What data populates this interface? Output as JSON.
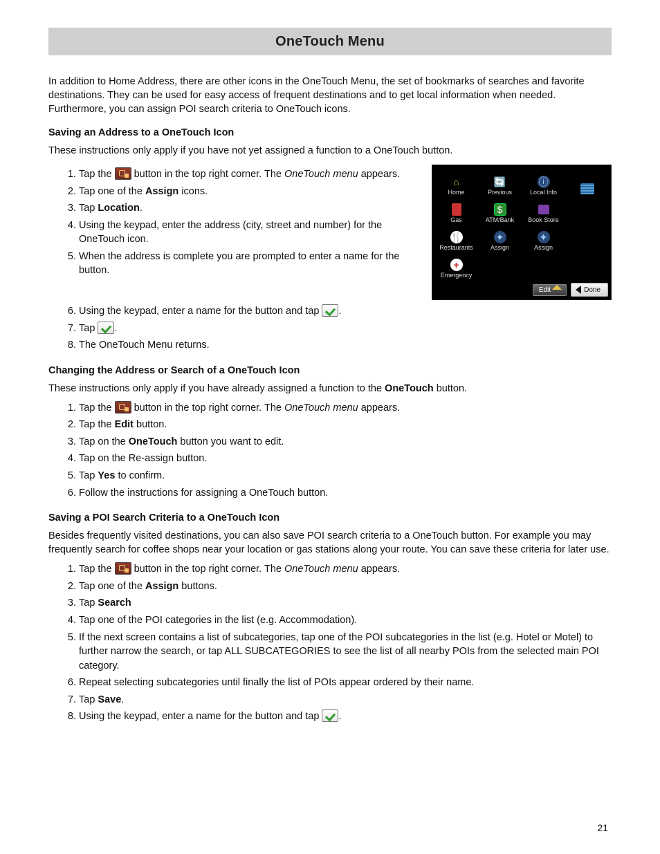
{
  "header_title": "OneTouch Menu",
  "intro": "In addition to Home Address, there are other icons in the OneTouch Menu, the set of bookmarks of searches and favorite destinations. They can be used for easy access of frequent destinations and to get local information when needed. Furthermore, you can assign POI search criteria to OneTouch icons.",
  "page_number": "21",
  "icon_names": {
    "onetouch": "onetouch-button-icon",
    "check": "confirm-check-icon"
  },
  "sec1": {
    "heading": "Saving an Address to a OneTouch Icon",
    "lead": "These instructions only apply if you have not yet assigned a function to a OneTouch button.",
    "steps": {
      "s1a": "Tap the ",
      "s1b": " button in the top right corner. The ",
      "s1c": "OneTouch menu",
      "s1d": " appears.",
      "s2a": "Tap one of the ",
      "s2b": "Assign",
      "s2c": " icons.",
      "s3a": "Tap ",
      "s3b": "Location",
      "s3c": ".",
      "s4": "Using the keypad, enter the address (city, street and number) for the OneTouch icon.",
      "s5": "When the address is complete you are prompted to enter a name for the button.",
      "s6a": "Using the keypad, enter a name for the button and tap ",
      "s6b": ".",
      "s7a": "Tap ",
      "s7b": ".",
      "s8": "The OneTouch Menu returns."
    }
  },
  "sec2": {
    "heading": "Changing the Address or Search of a OneTouch Icon",
    "lead_a": "These instructions only apply if you have already assigned a function to the ",
    "lead_b": "OneTouch",
    "lead_c": " button.",
    "steps": {
      "s1a": "Tap the ",
      "s1b": " button in the top right corner. The ",
      "s1c": "OneTouch menu",
      "s1d": " appears.",
      "s2a": "Tap the ",
      "s2b": "Edit",
      "s2c": " button.",
      "s3a": "Tap on the ",
      "s3b": "OneTouch",
      "s3c": " button you want to edit.",
      "s4": "Tap on the Re-assign button.",
      "s5a": "Tap ",
      "s5b": "Yes",
      "s5c": " to confirm.",
      "s6": "Follow the instructions for assigning a OneTouch button."
    }
  },
  "sec3": {
    "heading": "Saving a POI Search Criteria to a OneTouch Icon",
    "lead": "Besides frequently visited destinations, you can also save POI search criteria to a OneTouch button. For example you may frequently search for coffee shops near your location or gas stations along your route. You can save these criteria for later use.",
    "steps": {
      "s1a": "Tap the ",
      "s1b": " button in the top right corner. The ",
      "s1c": "OneTouch menu",
      "s1d": " appears.",
      "s2a": "Tap one of the ",
      "s2b": "Assign",
      "s2c": " buttons.",
      "s3a": "Tap ",
      "s3b": "Search",
      "s4": "Tap one of the POI categories in the list (e.g. Accommodation).",
      "s5": "If the next screen contains a list of subcategories, tap one of the POI subcategories in the list (e.g. Hotel or Motel) to further narrow the search, or tap ALL SUBCATEGORIES to see the list of all nearby POIs from the selected main POI category.",
      "s6": "Repeat selecting subcategories until finally the list of POIs appear ordered by their name.",
      "s7a": "Tap ",
      "s7b": "Save",
      "s7c": ".",
      "s8a": "Using the keypad, enter a name for the button and tap ",
      "s8b": "."
    }
  },
  "screenshot": {
    "cells": [
      {
        "label": "Home",
        "icon": "home"
      },
      {
        "label": "Previous",
        "icon": "previous"
      },
      {
        "label": "Local Info",
        "icon": "localinfo"
      },
      {
        "label": "",
        "icon": "stripes"
      },
      {
        "label": "Gas",
        "icon": "gas"
      },
      {
        "label": "ATM/Bank",
        "icon": "atm"
      },
      {
        "label": "Book Store",
        "icon": "book"
      },
      {
        "label": "",
        "icon": ""
      },
      {
        "label": "Restaurants",
        "icon": "restaurants"
      },
      {
        "label": "Assign",
        "icon": "assign"
      },
      {
        "label": "Assign",
        "icon": "assign"
      },
      {
        "label": "",
        "icon": ""
      },
      {
        "label": "Emergency",
        "icon": "emergency"
      },
      {
        "label": "",
        "icon": ""
      },
      {
        "label": "",
        "icon": ""
      },
      {
        "label": "",
        "icon": ""
      }
    ],
    "edit_label": "Edit",
    "done_label": "Done"
  }
}
